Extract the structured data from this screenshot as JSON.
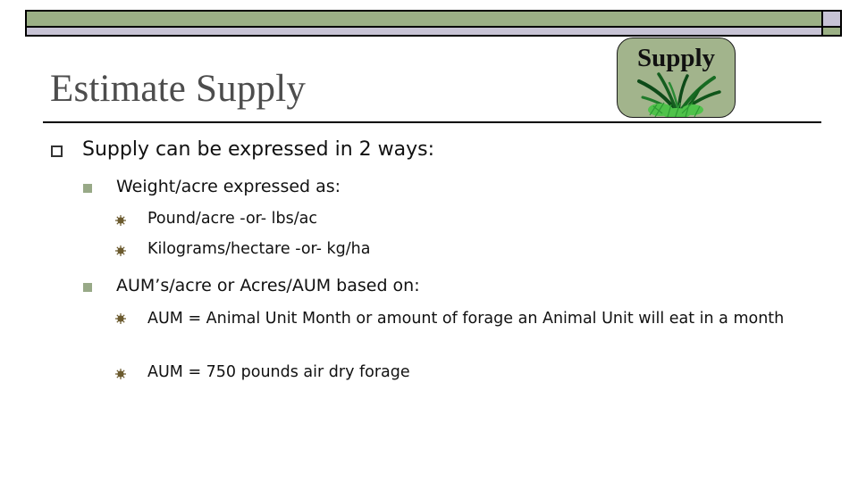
{
  "slide": {
    "title": "Estimate Supply",
    "badge": {
      "label": "Supply",
      "image_icon": "grass-plant-icon"
    },
    "colors": {
      "banner_green": "#9bb085",
      "banner_lavender": "#c7c3d5",
      "badge_bg": "#a2b48c",
      "title_text": "#4d4d4d",
      "sub_bullet": "#98a987",
      "star_bullet": "#6b5a2e"
    },
    "bullets": [
      {
        "text": "Supply can be expressed in 2 ways:",
        "children": [
          {
            "text": "Weight/acre expressed as:",
            "children": [
              {
                "text": "Pound/acre   -or-   lbs/ac"
              },
              {
                "text": "Kilograms/hectare   -or-  kg/ha"
              }
            ]
          },
          {
            "text": "AUM’s/acre or Acres/AUM based on:",
            "children": [
              {
                "text": "AUM = Animal Unit Month or amount of forage an Animal Unit will eat in a month"
              },
              {
                "text": "AUM = 750 pounds air dry forage"
              }
            ]
          }
        ]
      }
    ]
  }
}
